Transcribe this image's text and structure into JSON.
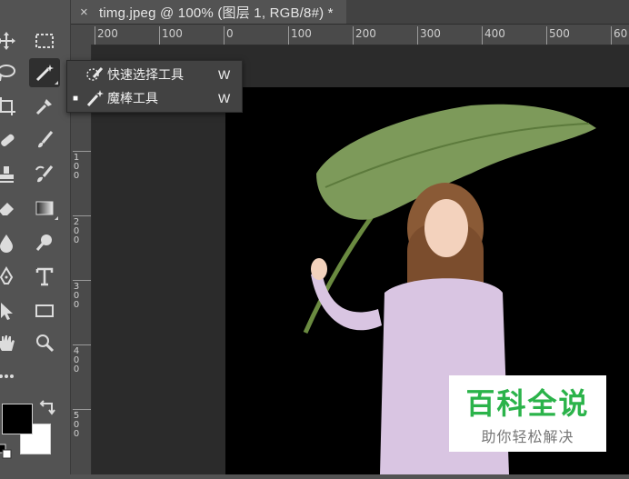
{
  "document_tab": {
    "close_glyph": "×",
    "title": "timg.jpeg @ 100% (图层 1, RGB/8#) *"
  },
  "ruler_horizontal": [
    "200",
    "100",
    "0",
    "100",
    "200",
    "300",
    "400",
    "500",
    "60"
  ],
  "ruler_vertical": [
    "1 0 0",
    "2 0 0",
    "3 0 0",
    "4 0 0",
    "5 0 0"
  ],
  "tool_flyout": {
    "items": [
      {
        "selected": false,
        "icon": "quick-selection-icon",
        "label": "快速选择工具",
        "shortcut": "W"
      },
      {
        "selected": true,
        "selected_mark": "■",
        "icon": "magic-wand-icon",
        "label": "魔棒工具",
        "shortcut": "W"
      }
    ]
  },
  "swatches": {
    "foreground": "#000000",
    "background": "#ffffff"
  },
  "watermark": {
    "title": "百科全说",
    "subtitle": "助你轻松解决"
  },
  "colors": {
    "panel": "#535353",
    "workspace": "#2b2b2b",
    "watermark_green": "#2bb34a"
  }
}
